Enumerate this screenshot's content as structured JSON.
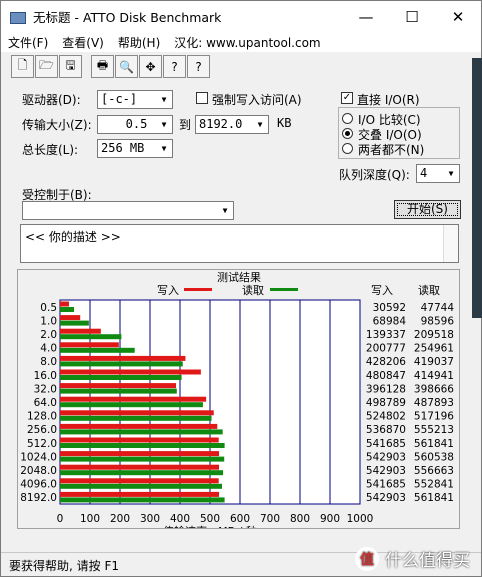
{
  "window": {
    "title": "无标题 - ATTO Disk Benchmark",
    "minimize": "—",
    "maximize": "☐",
    "close": "✕"
  },
  "menu": {
    "file": "文件(F)",
    "view": "查看(V)",
    "help": "帮助(H)",
    "localized": "汉化: www.upantool.com"
  },
  "toolbar": {
    "new": "🗋",
    "open": "🗁",
    "save": "🖫",
    "print": "🖶",
    "preview": "🔍",
    "move": "✥",
    "help": "?",
    "context_help": "?"
  },
  "form": {
    "drive_label": "驱动器(D):",
    "drive_value": "[-c-]",
    "transfer_label": "传输大小(Z):",
    "transfer_from": "0.5",
    "transfer_to_label": "到",
    "transfer_to": "8192.0",
    "transfer_unit": "KB",
    "total_label": "总长度(L):",
    "total_value": "256 MB",
    "force_write_label": "强制写入访问(A)",
    "force_write_checked": false,
    "direct_io_label": "直接 I/O(R)",
    "direct_io_checked": true,
    "io_compare_label": "I/O 比较(C)",
    "io_overlap_label": "交叠 I/O(O)",
    "neither_label": "两者都不(N)",
    "queue_depth_label": "队列深度(Q):",
    "queue_depth_value": "4",
    "controlled_by_label": "受控制于(B):",
    "controlled_by_value": "",
    "start_button": "开始(S)",
    "description_text": "<<   你的描述    >>"
  },
  "status": {
    "help_text": "要获得帮助, 请按 F1"
  },
  "watermark": {
    "icon": "值",
    "text": "什么值得买"
  },
  "chart_data": {
    "type": "bar",
    "title": "测试结果",
    "legend": [
      {
        "name": "写入",
        "color": "#e01818"
      },
      {
        "name": "读取",
        "color": "#108a10"
      }
    ],
    "xlabel": "传输速率 - MB / 秒",
    "xlim": [
      0,
      1000
    ],
    "xticks": [
      "0",
      "100",
      "200",
      "300",
      "400",
      "500",
      "600",
      "700",
      "800",
      "900",
      "1000"
    ],
    "write_header": "写入",
    "read_header": "读取",
    "categories": [
      "0.5",
      "1.0",
      "2.0",
      "4.0",
      "8.0",
      "16.0",
      "32.0",
      "64.0",
      "128.0",
      "256.0",
      "512.0",
      "1024.0",
      "2048.0",
      "4096.0",
      "8192.0"
    ],
    "series": [
      {
        "name": "写入",
        "values": [
          30592,
          68984,
          139337,
          200777,
          428206,
          480847,
          396128,
          498789,
          524802,
          536870,
          541685,
          542903,
          542903,
          541685,
          542903
        ]
      },
      {
        "name": "读取",
        "values": [
          47744,
          98596,
          209518,
          254961,
          419037,
          414941,
          398666,
          487893,
          517196,
          555213,
          561841,
          560538,
          556663,
          552841,
          561841
        ]
      }
    ]
  }
}
